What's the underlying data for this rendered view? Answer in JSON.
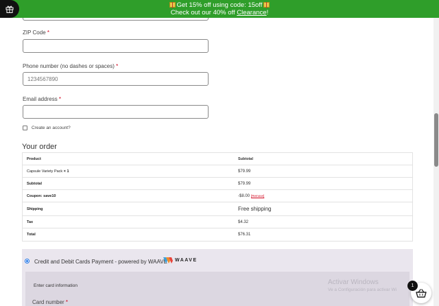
{
  "promo": {
    "line1": "Get 15% off using code: 15off",
    "line2_prefix": "Check out our 40% off ",
    "line2_link": "Clearance",
    "line2_suffix": "!"
  },
  "form": {
    "country_value": "",
    "zip_label": "ZIP Code",
    "zip_value": "",
    "phone_label": "Phone number (no dashes or spaces)",
    "phone_placeholder": "1234567890",
    "email_label": "Email address",
    "email_value": "",
    "required_mark": "*",
    "create_account_label": "Create an account?"
  },
  "order": {
    "title": "Your order",
    "header_product": "Product",
    "header_subtotal": "Subtotal",
    "item_name": "Capsule Variety Pack",
    "item_qty": "× 1",
    "item_price": "$79.99",
    "subtotal_label": "Subtotal",
    "subtotal_value": "$79.99",
    "coupon_label": "Coupon: save10",
    "coupon_value": "-$8.00",
    "coupon_remove": "[Remove]",
    "shipping_label": "Shipping",
    "shipping_value": "Free shipping",
    "tax_label": "Tax",
    "tax_value": "$4.32",
    "total_label": "Total",
    "total_value": "$76.31"
  },
  "payment": {
    "method_label": "Credit and Debit Cards Payment - powered by WAAVE",
    "logo_text": "WAAVE",
    "card_info_label": "Enter card information",
    "card_number_label": "Card number"
  },
  "watermark": {
    "line1": "Activar Windows",
    "line2": "Ve a Configuración para activar Wi"
  },
  "cart": {
    "count": "1"
  },
  "colors": {
    "promo_green": "#2f9e2a",
    "required_red": "#d0021b",
    "payment_bg": "#eae6ee"
  }
}
